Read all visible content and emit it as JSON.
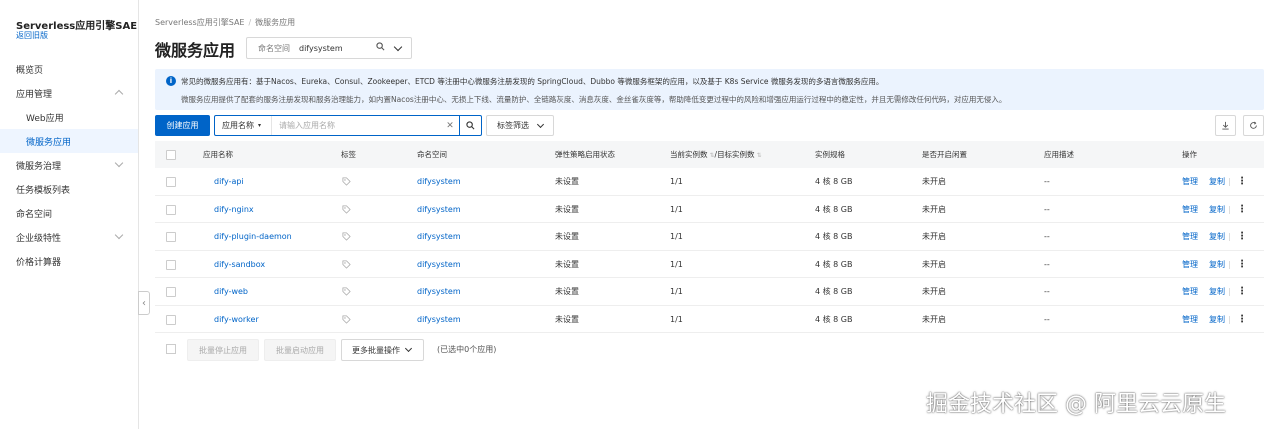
{
  "sidebar": {
    "title": "Serverless应用引擎SAE",
    "back_link": "返回旧版",
    "items": [
      {
        "label": "概览页"
      },
      {
        "label": "应用管理"
      },
      {
        "label": "Web应用"
      },
      {
        "label": "微服务应用"
      },
      {
        "label": "微服务治理"
      },
      {
        "label": "任务模板列表"
      },
      {
        "label": "命名空间"
      },
      {
        "label": "企业级特性"
      },
      {
        "label": "价格计算器"
      }
    ],
    "collapse_glyph": "‹"
  },
  "breadcrumb": {
    "root": "Serverless应用引擎SAE",
    "separator": "/",
    "current": "微服务应用"
  },
  "page": {
    "title": "微服务应用",
    "namespace_label": "命名空间",
    "namespace_value": "difysystem"
  },
  "info": {
    "line1": "常见的微服务应用有：基于Nacos、Eureka、Consul、Zookeeper、ETCD 等注册中心微服务注册发现的 SpringCloud、Dubbo 等微服务框架的应用，以及基于 K8s Service 微服务发现的多语言微服务应用。",
    "line2": "微服务应用提供了配套的服务注册发现和服务治理能力，如内置Nacos注册中心、无损上下线、流量防护、全链路灰度、消息灰度、金丝雀灰度等，帮助降低变更过程中的风险和增强应用运行过程中的稳定性，并且无需修改任何代码，对应用无侵入。"
  },
  "toolbar": {
    "create_label": "创建应用",
    "search_type": "应用名称",
    "search_placeholder": "请输入应用名称",
    "tag_filter_label": "标签筛选"
  },
  "table": {
    "headers": {
      "name": "应用名称",
      "tag": "标签",
      "namespace": "命名空间",
      "policy": "弹性策略启用状态",
      "instances": "当前实例数",
      "instances_sep": "/",
      "target": "目标实例数",
      "spec": "实例规格",
      "idle": "是否开启闲置",
      "desc": "应用描述",
      "ops": "操作"
    },
    "rows": [
      {
        "name": "dify-api",
        "namespace": "difysystem",
        "policy": "未设置",
        "instances": "1/1",
        "spec": "4 核 8 GB",
        "idle": "未开启",
        "desc": "--",
        "manage": "管理",
        "copy": "复制"
      },
      {
        "name": "dify-nginx",
        "namespace": "difysystem",
        "policy": "未设置",
        "instances": "1/1",
        "spec": "4 核 8 GB",
        "idle": "未开启",
        "desc": "--",
        "manage": "管理",
        "copy": "复制"
      },
      {
        "name": "dify-plugin-daemon",
        "namespace": "difysystem",
        "policy": "未设置",
        "instances": "1/1",
        "spec": "4 核 8 GB",
        "idle": "未开启",
        "desc": "--",
        "manage": "管理",
        "copy": "复制"
      },
      {
        "name": "dify-sandbox",
        "namespace": "difysystem",
        "policy": "未设置",
        "instances": "1/1",
        "spec": "4 核 8 GB",
        "idle": "未开启",
        "desc": "--",
        "manage": "管理",
        "copy": "复制"
      },
      {
        "name": "dify-web",
        "namespace": "difysystem",
        "policy": "未设置",
        "instances": "1/1",
        "spec": "4 核 8 GB",
        "idle": "未开启",
        "desc": "--",
        "manage": "管理",
        "copy": "复制"
      },
      {
        "name": "dify-worker",
        "namespace": "difysystem",
        "policy": "未设置",
        "instances": "1/1",
        "spec": "4 核 8 GB",
        "idle": "未开启",
        "desc": "--",
        "manage": "管理",
        "copy": "复制"
      }
    ]
  },
  "footer": {
    "batch_stop": "批量停止应用",
    "batch_start": "批量启动应用",
    "more_batch": "更多批量操作",
    "selected_count": "(已选中0个应用)"
  },
  "watermark": "掘金技术社区 @ 阿里云云原生",
  "colors": {
    "accent": "#0064c8",
    "info_bg": "#ebf3fe",
    "active_bg": "#eef5ff"
  }
}
